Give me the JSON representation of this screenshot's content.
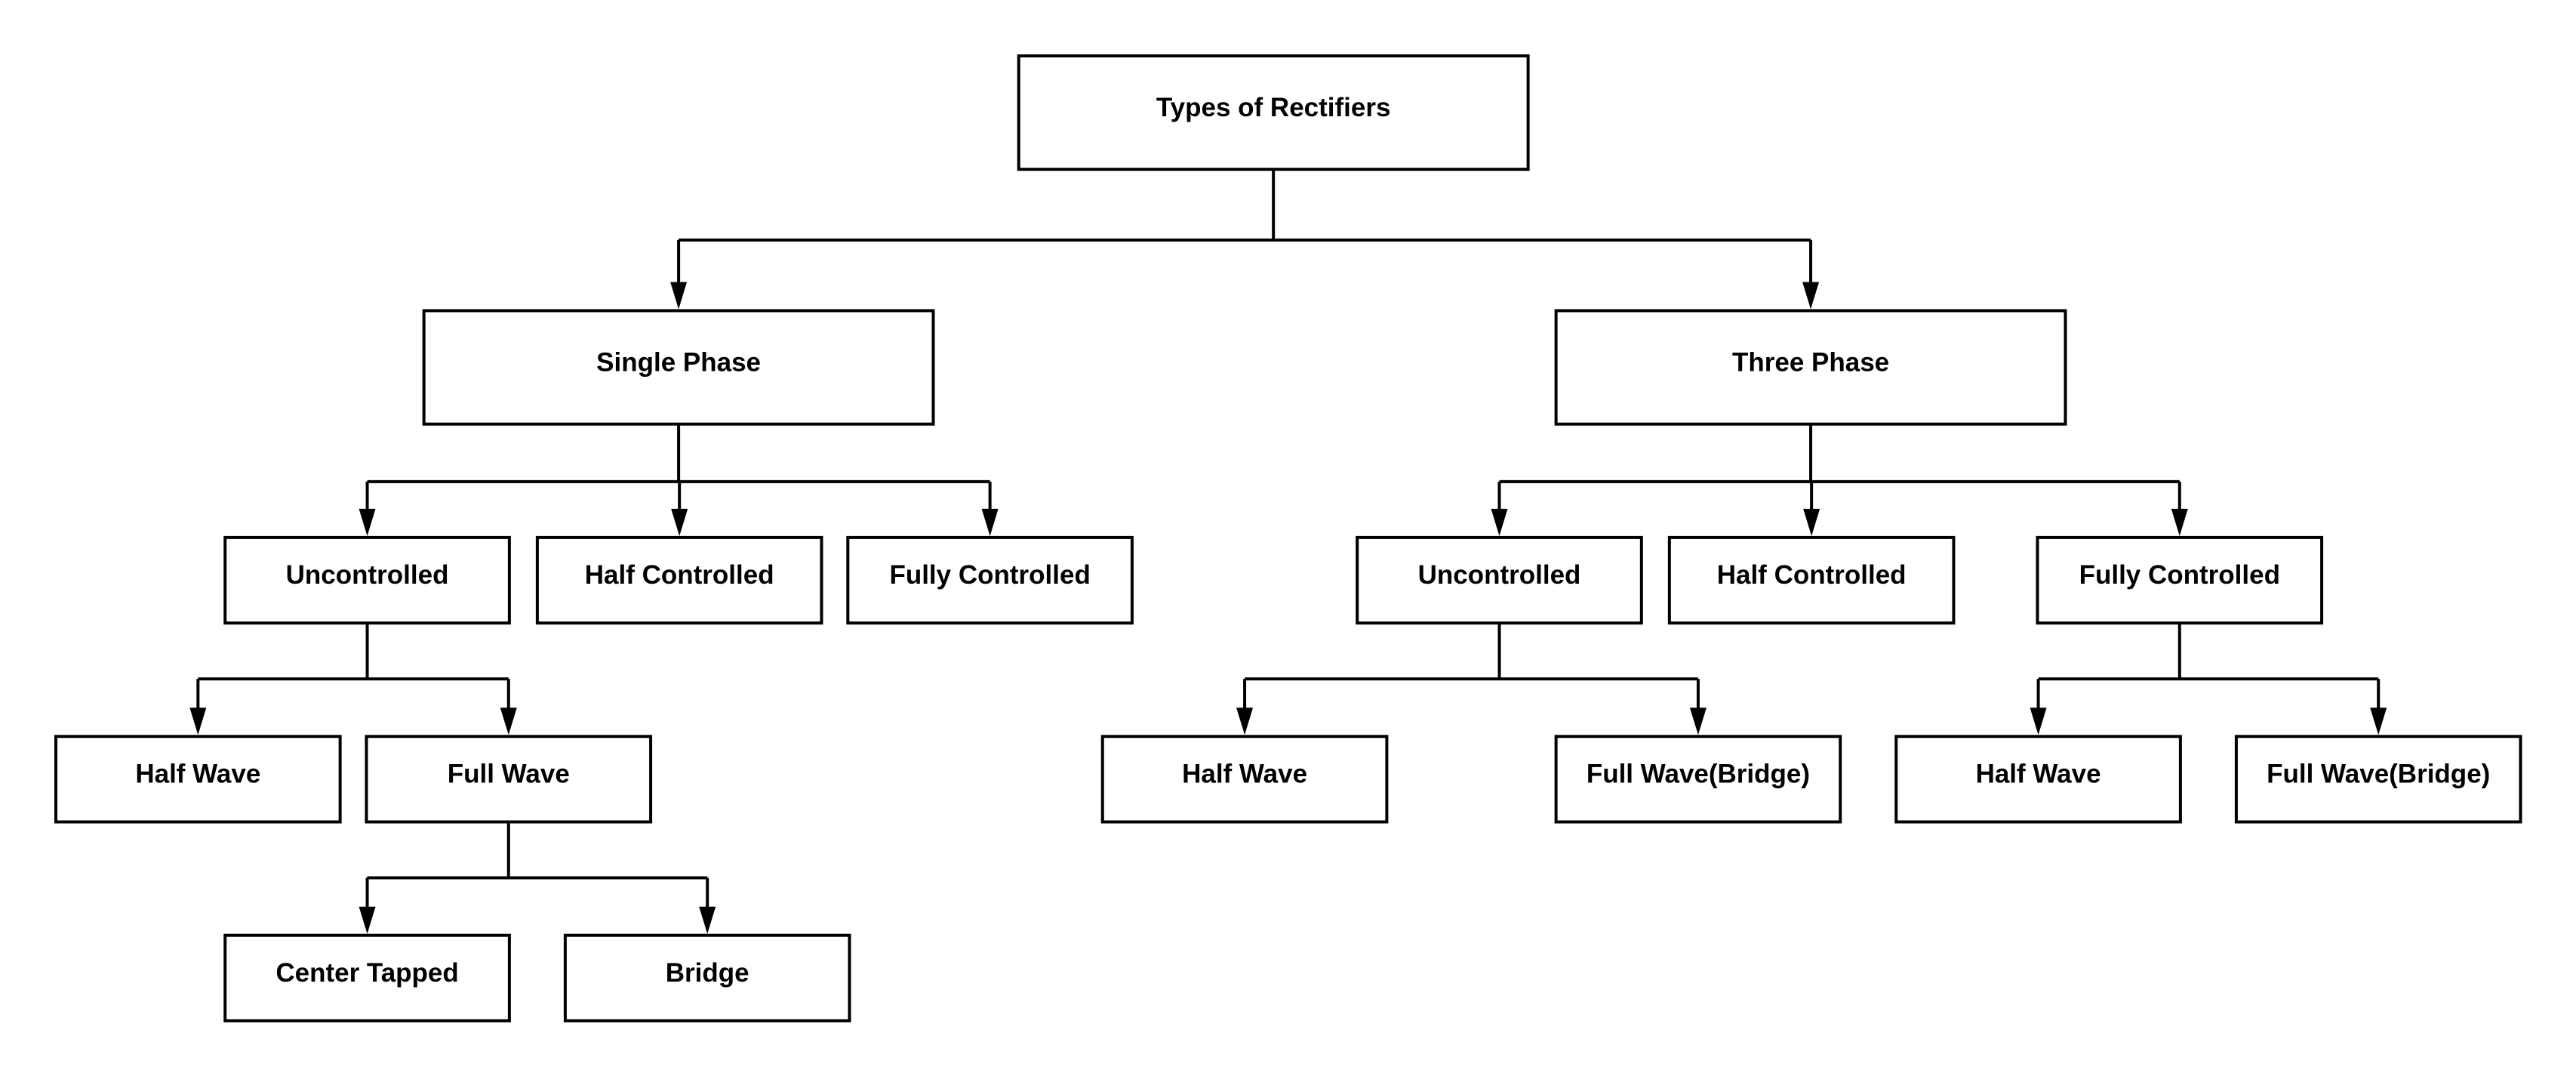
{
  "title": "Types of Rectifiers",
  "colors": {
    "stroke": "#000000",
    "fill": "#ffffff",
    "text": "#000000"
  },
  "nodes": {
    "root": {
      "label": "Types of Rectifiers"
    },
    "single_phase": {
      "label": "Single Phase"
    },
    "three_phase": {
      "label": "Three Phase"
    },
    "sp_uncontrolled": {
      "label": "Uncontrolled"
    },
    "sp_half_controlled": {
      "label": "Half Controlled"
    },
    "sp_fully_controlled": {
      "label": "Fully Controlled"
    },
    "tp_uncontrolled": {
      "label": "Uncontrolled"
    },
    "tp_half_controlled": {
      "label": "Half Controlled"
    },
    "tp_fully_controlled": {
      "label": "Fully Controlled"
    },
    "sp_half_wave": {
      "label": "Half Wave"
    },
    "sp_full_wave": {
      "label": "Full Wave"
    },
    "tp_unc_half_wave": {
      "label": "Half Wave"
    },
    "tp_unc_full_wave_bridge": {
      "label": "Full Wave(Bridge)"
    },
    "tp_fc_half_wave": {
      "label": "Half Wave"
    },
    "tp_fc_full_wave_bridge": {
      "label": "Full Wave(Bridge)"
    },
    "sp_center_tapped": {
      "label": "Center Tapped"
    },
    "sp_bridge": {
      "label": "Bridge"
    }
  },
  "edges": [
    {
      "from": "root",
      "to": [
        "single_phase",
        "three_phase"
      ]
    },
    {
      "from": "single_phase",
      "to": [
        "sp_uncontrolled",
        "sp_half_controlled",
        "sp_fully_controlled"
      ]
    },
    {
      "from": "three_phase",
      "to": [
        "tp_uncontrolled",
        "tp_half_controlled",
        "tp_fully_controlled"
      ]
    },
    {
      "from": "sp_uncontrolled",
      "to": [
        "sp_half_wave",
        "sp_full_wave"
      ]
    },
    {
      "from": "tp_uncontrolled",
      "to": [
        "tp_unc_half_wave",
        "tp_unc_full_wave_bridge"
      ]
    },
    {
      "from": "tp_fully_controlled",
      "to": [
        "tp_fc_half_wave",
        "tp_fc_full_wave_bridge"
      ]
    },
    {
      "from": "sp_full_wave",
      "to": [
        "sp_center_tapped",
        "sp_bridge"
      ]
    }
  ]
}
